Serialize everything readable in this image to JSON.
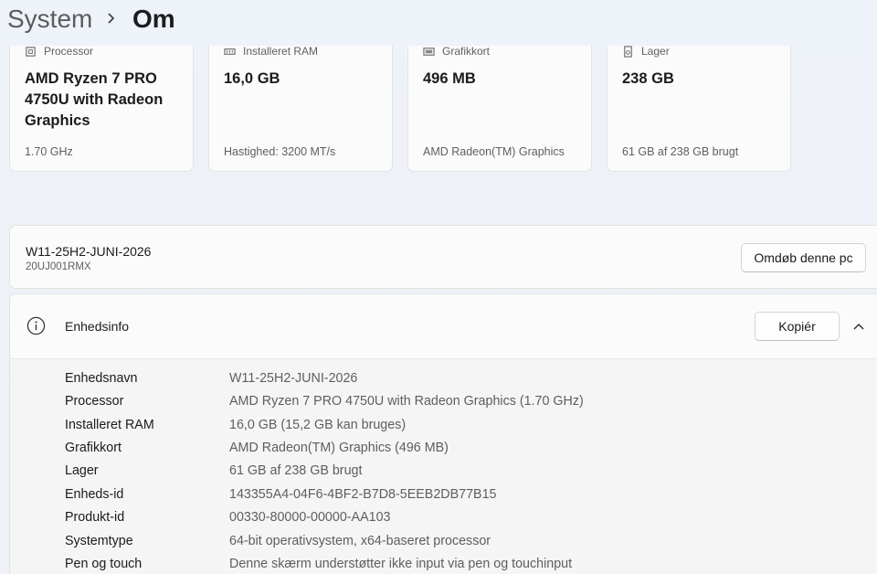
{
  "header": {
    "parent": "System",
    "current": "Om"
  },
  "cards": [
    {
      "icon": "processor-icon",
      "label": "Processor",
      "value": "AMD Ryzen 7 PRO 4750U with Radeon Graphics",
      "sub": "1.70 GHz"
    },
    {
      "icon": "ram-icon",
      "label": "Installeret RAM",
      "value": "16,0 GB",
      "sub": "Hastighed: 3200 MT/s"
    },
    {
      "icon": "gpu-icon",
      "label": "Grafikkort",
      "value": "496 MB",
      "sub": "AMD Radeon(TM) Graphics"
    },
    {
      "icon": "storage-icon",
      "label": "Lager",
      "value": "238 GB",
      "sub": "61 GB af 238 GB brugt"
    }
  ],
  "pc": {
    "name": "W11-25H2-JUNI-2026",
    "model": "20UJ001RMX",
    "rename_label": "Omdøb denne pc"
  },
  "device_info": {
    "title": "Enhedsinfo",
    "copy_label": "Kopiér",
    "rows": [
      {
        "key": "Enhedsnavn",
        "value": "W11-25H2-JUNI-2026"
      },
      {
        "key": "Processor",
        "value": "AMD Ryzen 7 PRO 4750U with Radeon Graphics (1.70 GHz)"
      },
      {
        "key": "Installeret RAM",
        "value": "16,0 GB (15,2 GB kan bruges)"
      },
      {
        "key": "Grafikkort",
        "value": "AMD Radeon(TM) Graphics (496 MB)"
      },
      {
        "key": "Lager",
        "value": "61 GB af 238 GB brugt"
      },
      {
        "key": "Enheds-id",
        "value": "143355A4-04F6-4BF2-B7D8-5EEB2DB77B15"
      },
      {
        "key": "Produkt-id",
        "value": "00330-80000-00000-AA103"
      },
      {
        "key": "Systemtype",
        "value": "64-bit operativsystem, x64-baseret processor"
      },
      {
        "key": "Pen og touch",
        "value": "Denne skærm understøtter ikke input via pen og touchinput"
      }
    ]
  }
}
